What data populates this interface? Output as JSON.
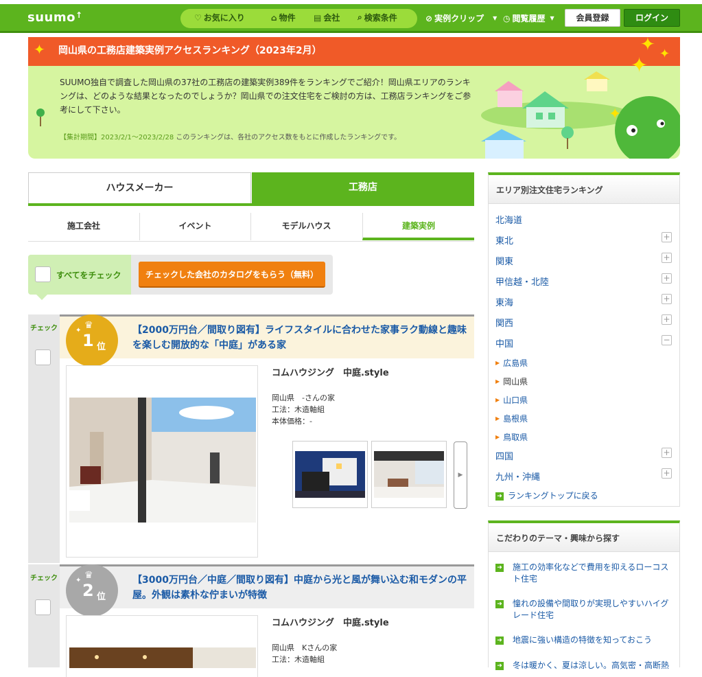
{
  "header": {
    "logo": "suumo",
    "nav": [
      {
        "label": "お気に入り",
        "icon": "heart-icon"
      },
      {
        "label": "物件",
        "icon": "house-icon"
      },
      {
        "label": "会社",
        "icon": "building-icon"
      },
      {
        "label": "検索条件",
        "icon": "search-icon"
      }
    ],
    "clip_label": "実例クリップ",
    "history_label": "閲覧履歴",
    "register_label": "会員登録",
    "login_label": "ログイン",
    "colors": {
      "brand": "#5cb41e",
      "accent": "#f05a28"
    }
  },
  "banner": {
    "title": "岡山県の工務店建築実例アクセスランキング（2023年2月）",
    "description": "SUUMO独自で調査した岡山県の37社の工務店の建築実例389件をランキングでご紹介！岡山県エリアのランキングは、どのような結果となったのでしょうか？岡山県での注文住宅をご検討の方は、工務店ランキングをご参考にして下さい。",
    "period_label": "【集計期間】2023/2/1〜2023/2/28",
    "period_note": "このランキングは、各社のアクセス数をもとに作成したランキングです。"
  },
  "tabs": {
    "left": "ハウスメーカー",
    "right": "工務店"
  },
  "subtabs": [
    "施工会社",
    "イベント",
    "モデルハウス",
    "建築実例"
  ],
  "checkbar": {
    "check_all": "すべてをチェック",
    "catalog_button": "チェックした会社のカタログをもらう（無料）"
  },
  "entries": [
    {
      "check_label": "チェック",
      "rank": "1",
      "rank_suffix": "位",
      "title": "【2000万円台／間取り図有】ライフスタイルに合わせた家事ラク動線と趣味を楽しむ開放的な「中庭」がある家",
      "company": "コムハウジング　中庭.style",
      "location": "岡山県　-さんの家",
      "method": "工法：木造軸組",
      "price": "本体価格：-",
      "next": "▶"
    },
    {
      "check_label": "チェック",
      "rank": "2",
      "rank_suffix": "位",
      "title": "【3000万円台／中庭／間取り図有】中庭から光と風が舞い込む和モダンの平屋。外観は素朴な佇まいが特徴",
      "company": "コムハウジング　中庭.style",
      "location": "岡山県　Kさんの家",
      "method": "工法：木造軸組"
    }
  ],
  "sidebar": {
    "area_title": "エリア別注文住宅ランキング",
    "areas": [
      "北海道",
      "東北",
      "関東",
      "甲信越・北陸",
      "東海",
      "関西",
      "中国",
      "四国",
      "九州・沖縄"
    ],
    "chugoku_sub": [
      "広島県",
      "岡山県",
      "山口県",
      "島根県",
      "鳥取県"
    ],
    "back_link": "ランキングトップに戻る",
    "theme_title": "こだわりのテーマ・興味から探す",
    "themes": [
      "施工の効率化などで費用を抑えるローコスト住宅",
      "憧れの設備や間取りが実現しやすいハイグレード住宅",
      "地震に強い構造の特徴を知っておこう",
      "冬は暖かく、夏は涼しい。高気密・高断熱"
    ]
  }
}
